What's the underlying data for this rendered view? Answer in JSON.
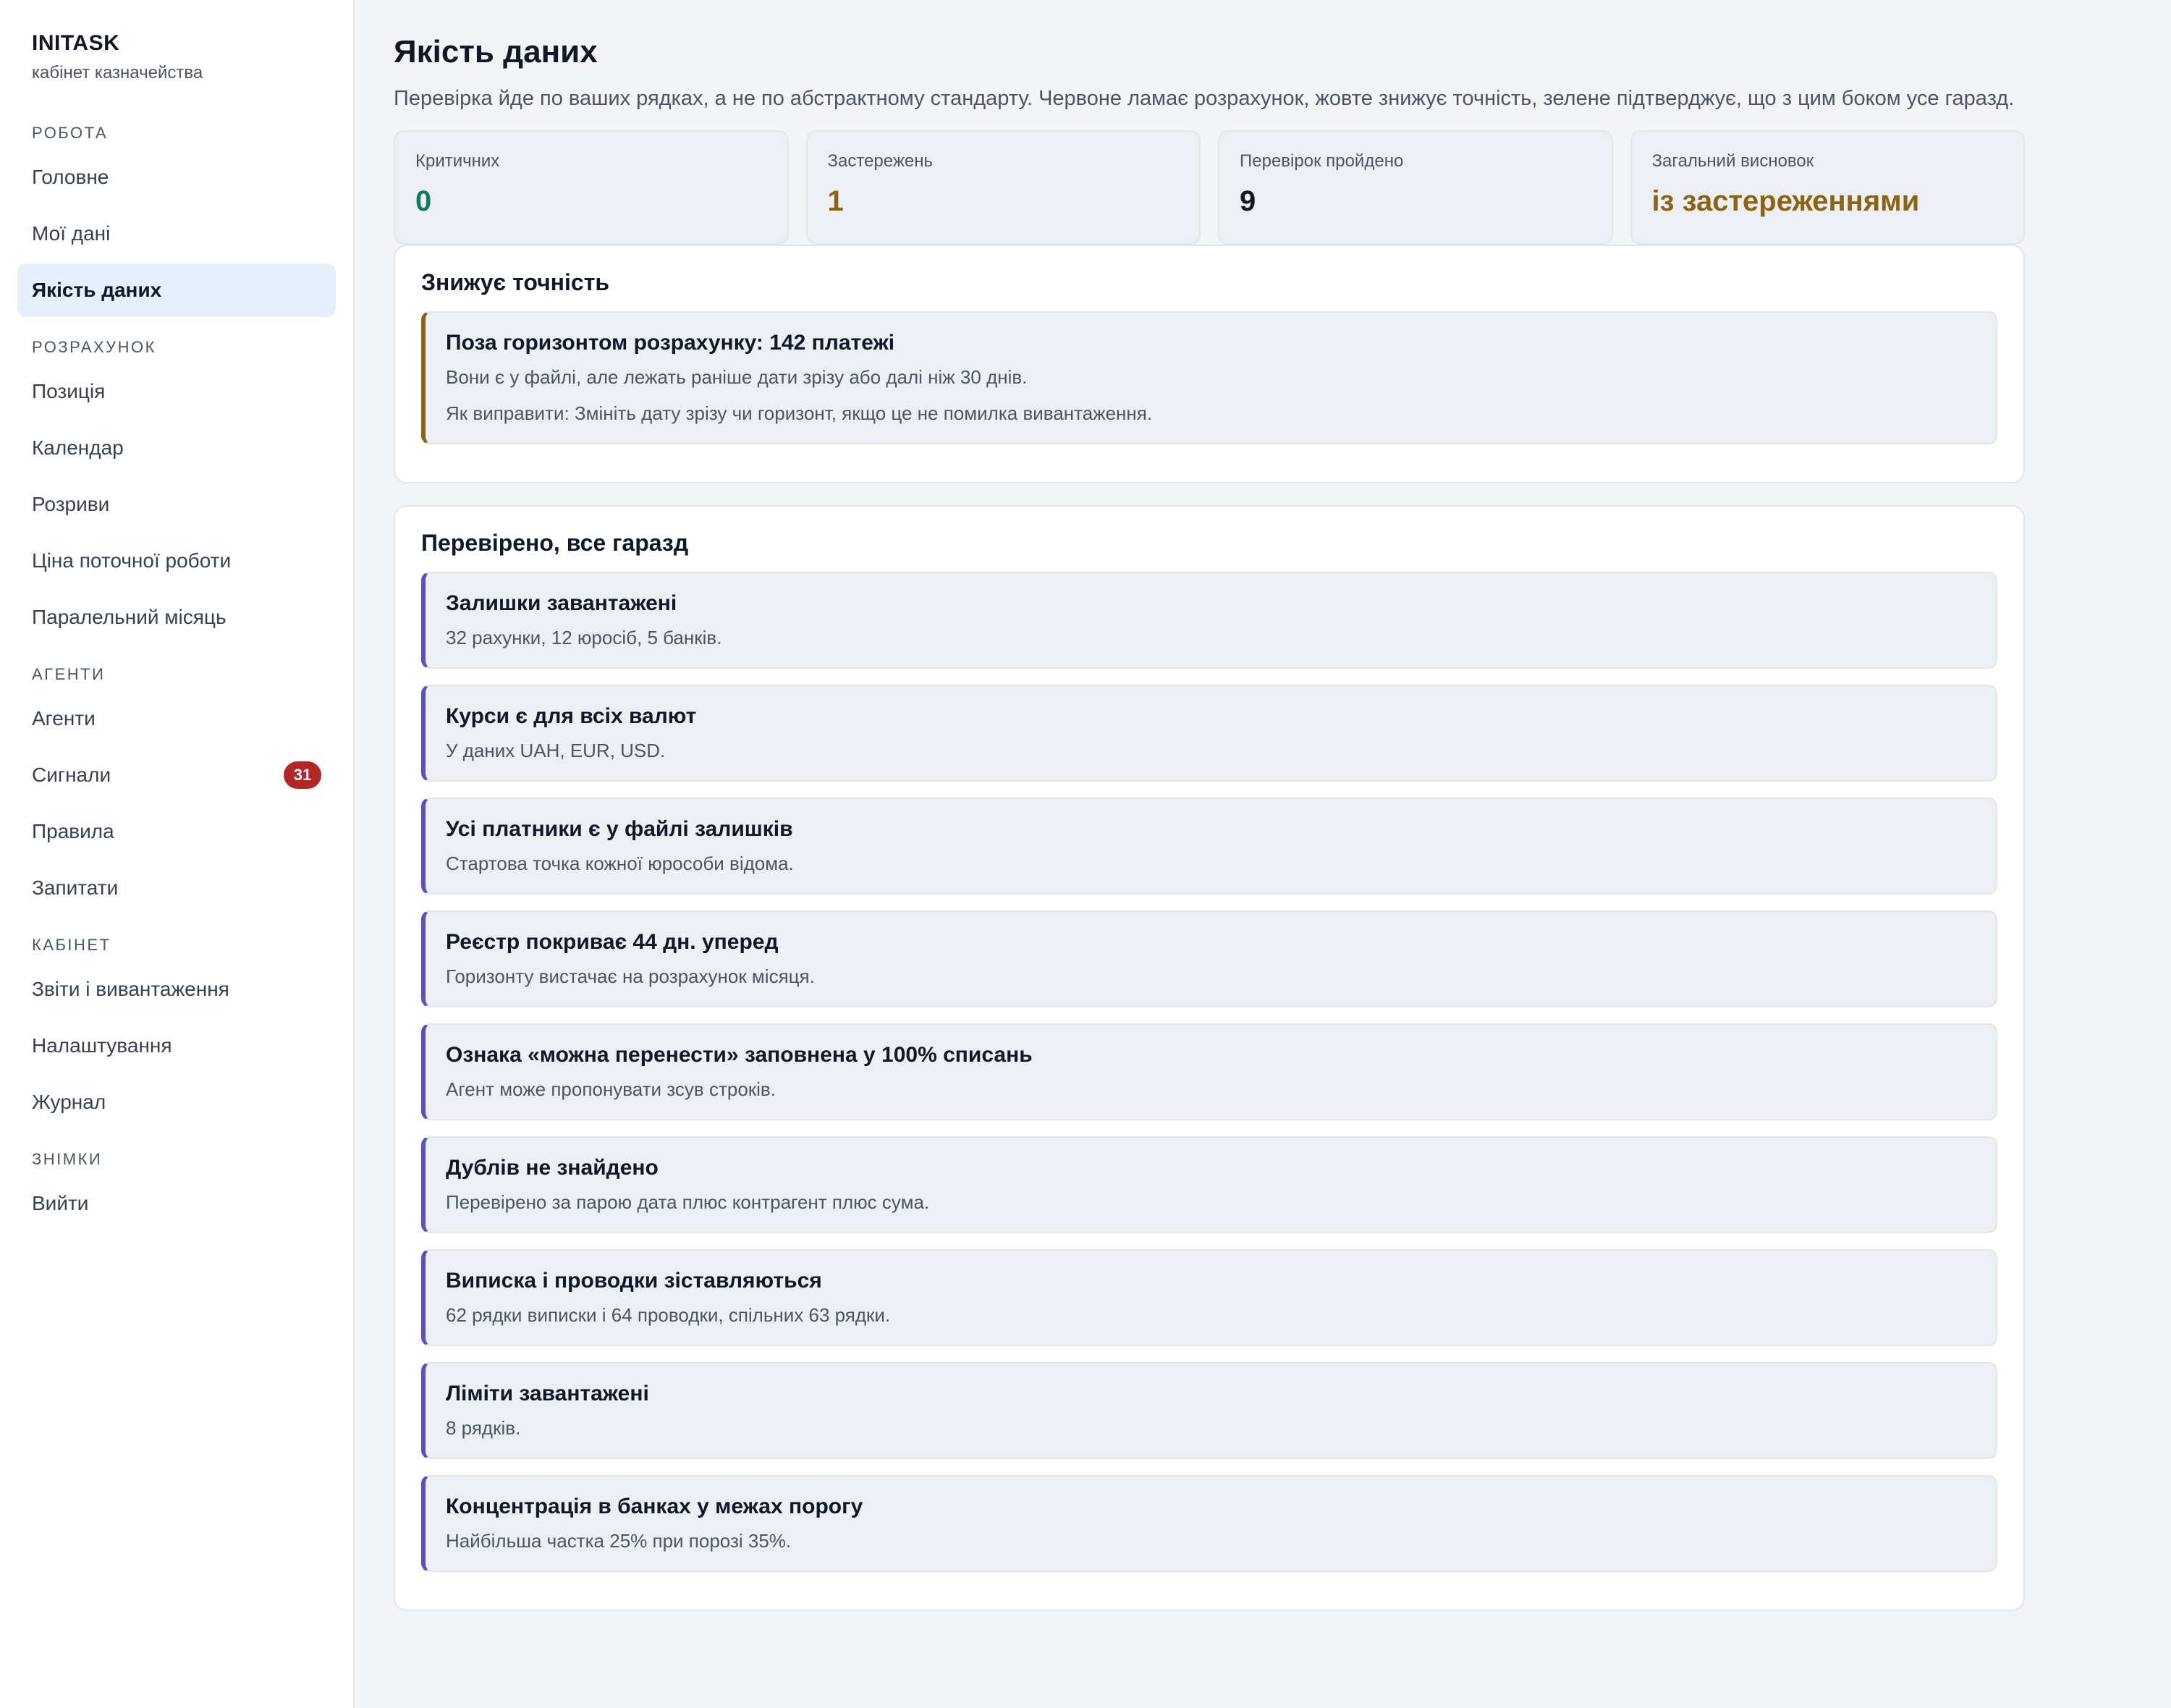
{
  "sidebar": {
    "brand": "INITASK",
    "brand_sub": "кабінет казначейства",
    "sections": [
      {
        "label": "РОБОТА",
        "items": [
          "Головне",
          "Мої дані",
          "Якість даних"
        ]
      },
      {
        "label": "РОЗРАХУНОК",
        "items": [
          "Позиція",
          "Календар",
          "Розриви",
          "Ціна поточної роботи",
          "Паралельний місяць"
        ]
      },
      {
        "label": "АГЕНТИ",
        "items": [
          "Агенти",
          "Сигнали",
          "Правила",
          "Запитати"
        ]
      },
      {
        "label": "КАБІНЕТ",
        "items": [
          "Звіти і вивантаження",
          "Налаштування",
          "Журнал"
        ]
      },
      {
        "label": "ЗНІМКИ",
        "items": [
          "Вийти"
        ]
      }
    ],
    "active_item": "Якість даних",
    "signals_badge": "31"
  },
  "header": {
    "title": "Якість даних",
    "description": "Перевірка йде по ваших рядках, а не по абстрактному стандарту. Червоне ламає розрахунок, жовте знижує точність, зелене підтверджує, що з цим боком усе гаразд."
  },
  "stats": [
    {
      "label": "Критичних",
      "value": "0"
    },
    {
      "label": "Застережень",
      "value": "1"
    },
    {
      "label": "Перевірок пройдено",
      "value": "9"
    },
    {
      "label": "Загальний висновок",
      "value": "із застереженнями"
    }
  ],
  "warnings": {
    "title": "Знижує точність",
    "items": [
      {
        "title": "Поза горизонтом розрахунку: 142 платежі",
        "text": "Вони є у файлі, але лежать раніше дати зрізу або далі ніж 30 днів.",
        "fix": "Як виправити: Змініть дату зрізу чи горизонт, якщо це не помилка вивантаження."
      }
    ]
  },
  "passed": {
    "title": "Перевірено, все гаразд",
    "items": [
      {
        "title": "Залишки завантажені",
        "text": "32 рахунки, 12 юросіб, 5 банків."
      },
      {
        "title": "Курси є для всіх валют",
        "text": "У даних UAH, EUR, USD."
      },
      {
        "title": "Усі платники є у файлі залишків",
        "text": "Стартова точка кожної юрособи відома."
      },
      {
        "title": "Реєстр покриває 44 дн. уперед",
        "text": "Горизонту вистачає на розрахунок місяця."
      },
      {
        "title": "Ознака «можна перенести» заповнена у 100% списань",
        "text": "Агент може пропонувати зсув строків."
      },
      {
        "title": "Дублів не знайдено",
        "text": "Перевірено за парою дата плюс контрагент плюс сума."
      },
      {
        "title": "Виписка і проводки зіставляються",
        "text": "62 рядки виписки і 64 проводки, спільних 63 рядки."
      },
      {
        "title": "Ліміти завантажені",
        "text": "8 рядків."
      },
      {
        "title": "Концентрація в банках у межах порогу",
        "text": "Найбільша частка 25% при порозі 35%."
      }
    ]
  }
}
